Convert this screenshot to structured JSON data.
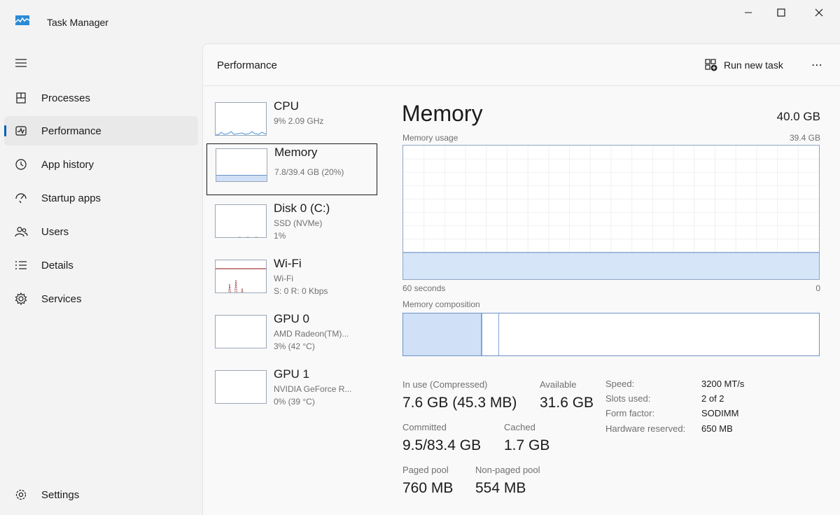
{
  "window": {
    "title": "Task Manager",
    "controls": {
      "minimize": "minimize",
      "maximize": "maximize",
      "close": "close"
    }
  },
  "sidebar": {
    "items": [
      {
        "label": "Processes",
        "icon": "processes-icon"
      },
      {
        "label": "Performance",
        "icon": "performance-icon",
        "active": true
      },
      {
        "label": "App history",
        "icon": "app-history-icon"
      },
      {
        "label": "Startup apps",
        "icon": "startup-apps-icon"
      },
      {
        "label": "Users",
        "icon": "users-icon"
      },
      {
        "label": "Details",
        "icon": "details-icon"
      },
      {
        "label": "Services",
        "icon": "services-icon"
      }
    ],
    "settings_label": "Settings"
  },
  "header": {
    "title": "Performance",
    "run_new_task": "Run new task",
    "more": "⋯"
  },
  "devices": [
    {
      "name": "CPU",
      "line1": "9% 2.09 GHz",
      "line2": ""
    },
    {
      "name": "Memory",
      "line1": "7.8/39.4 GB (20%)",
      "line2": "",
      "selected": true
    },
    {
      "name": "Disk 0 (C:)",
      "line1": "SSD (NVMe)",
      "line2": "1%"
    },
    {
      "name": "Wi-Fi",
      "line1": "Wi-Fi",
      "line2": "S: 0 R: 0 Kbps"
    },
    {
      "name": "GPU 0",
      "line1": "AMD Radeon(TM)...",
      "line2": "3% (42 °C)"
    },
    {
      "name": "GPU 1",
      "line1": "NVIDIA GeForce R...",
      "line2": "0% (39 °C)"
    }
  ],
  "detail": {
    "title": "Memory",
    "total": "40.0 GB",
    "usage_label": "Memory usage",
    "usage_max": "39.4 GB",
    "axis_left": "60 seconds",
    "axis_right": "0",
    "usage_fraction": 0.2,
    "composition_label": "Memory composition",
    "composition": {
      "in_use_fraction": 0.19,
      "modified_fraction": 0.04
    },
    "stats": {
      "in_use_label": "In use (Compressed)",
      "in_use_value": "7.6 GB (45.3 MB)",
      "available_label": "Available",
      "available_value": "31.6 GB",
      "committed_label": "Committed",
      "committed_value": "9.5/83.4 GB",
      "cached_label": "Cached",
      "cached_value": "1.7 GB",
      "paged_label": "Paged pool",
      "paged_value": "760 MB",
      "nonpaged_label": "Non-paged pool",
      "nonpaged_value": "554 MB"
    },
    "specs": {
      "speed_label": "Speed:",
      "speed_value": "3200 MT/s",
      "slots_label": "Slots used:",
      "slots_value": "2 of 2",
      "form_label": "Form factor:",
      "form_value": "SODIMM",
      "reserved_label": "Hardware reserved:",
      "reserved_value": "650 MB"
    }
  },
  "colors": {
    "accent": "#005fb8",
    "memory_fill": "#cfe0f7",
    "memory_line": "#6c93c7",
    "wifi_line": "#a33a3a"
  }
}
